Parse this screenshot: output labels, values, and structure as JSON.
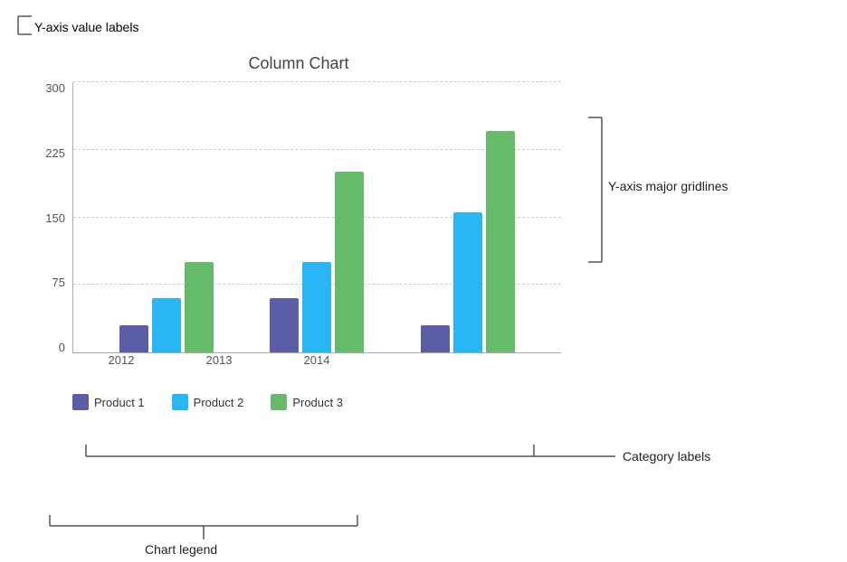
{
  "chart": {
    "title": "Column Chart",
    "yAxis": {
      "labels": [
        "300",
        "225",
        "150",
        "75",
        "0"
      ],
      "max": 300
    },
    "categories": [
      "2012",
      "2013",
      "2014"
    ],
    "series": [
      {
        "name": "Product 1",
        "color": "#5b5ea6",
        "values": [
          30,
          60,
          30
        ]
      },
      {
        "name": "Product 2",
        "color": "#29b6f6",
        "values": [
          60,
          100,
          155
        ]
      },
      {
        "name": "Product 3",
        "color": "#66bb6a",
        "values": [
          100,
          200,
          245
        ]
      }
    ],
    "legend": {
      "items": [
        "Product 1",
        "Product 2",
        "Product 3"
      ]
    }
  },
  "annotations": {
    "yAxisLabel": "Y-axis value labels",
    "yAxisGridlines": "Y-axis major gridlines",
    "categoryLabels": "Category labels",
    "chartLegend": "Chart legend"
  }
}
